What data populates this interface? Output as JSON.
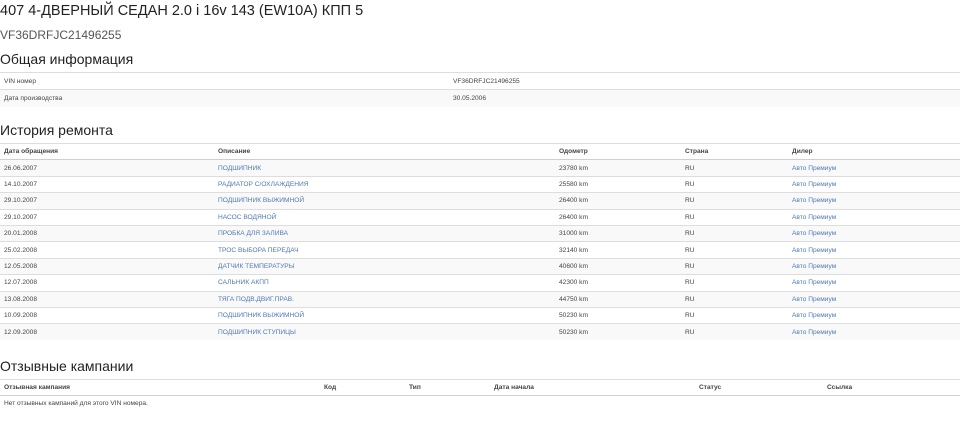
{
  "header": {
    "title": "407 4-ДВЕРНЫЙ СЕДАН 2.0 i 16v 143 (EW10A) КПП 5",
    "vin": "VF36DRFJC21496255"
  },
  "general": {
    "title": "Общая информация",
    "rows": [
      {
        "label": "VIN номер",
        "value": "VF36DRFJC21496255"
      },
      {
        "label": "Дата производства",
        "value": "30.05.2006"
      }
    ]
  },
  "history": {
    "title": "История ремонта",
    "columns": [
      "Дата обращения",
      "Описание",
      "Одометр",
      "Страна",
      "Дилер"
    ],
    "rows": [
      {
        "date": "26.06.2007",
        "desc": "ПОДШИПНИК",
        "odo": "23780 km",
        "country": "RU",
        "dealer": "Авто Премиум"
      },
      {
        "date": "14.10.2007",
        "desc": "РАДИАТОР С/ОХЛАЖДЕНИЯ",
        "odo": "25580 km",
        "country": "RU",
        "dealer": "Авто Премиум"
      },
      {
        "date": "29.10.2007",
        "desc": "ПОДШИПНИК ВЫЖИМНОЙ",
        "odo": "26400 km",
        "country": "RU",
        "dealer": "Авто Премиум"
      },
      {
        "date": "29.10.2007",
        "desc": "НАСОС ВОДЯНОЙ",
        "odo": "26400 km",
        "country": "RU",
        "dealer": "Авто Премиум"
      },
      {
        "date": "20.01.2008",
        "desc": "ПРОБКА ДЛЯ ЗАЛИВА",
        "odo": "31000 km",
        "country": "RU",
        "dealer": "Авто Премиум"
      },
      {
        "date": "25.02.2008",
        "desc": "ТРОС ВЫБОРА ПЕРЕДАЧ",
        "odo": "32140 km",
        "country": "RU",
        "dealer": "Авто Премиум"
      },
      {
        "date": "12.05.2008",
        "desc": "ДАТЧИК ТЕМПЕРАТУРЫ",
        "odo": "40600 km",
        "country": "RU",
        "dealer": "Авто Премиум"
      },
      {
        "date": "12.07.2008",
        "desc": "САЛЬНИК АКПП",
        "odo": "42300 km",
        "country": "RU",
        "dealer": "Авто Премиум"
      },
      {
        "date": "13.08.2008",
        "desc": "ТЯГА ПОДВ.ДВИГ.ПРАВ.",
        "odo": "44750 km",
        "country": "RU",
        "dealer": "Авто Премиум"
      },
      {
        "date": "10.09.2008",
        "desc": "ПОДШИПНИК ВЫЖИМНОЙ",
        "odo": "50230 km",
        "country": "RU",
        "dealer": "Авто Премиум"
      },
      {
        "date": "12.09.2008",
        "desc": "ПОДШИПНИК СТУПИЦЫ",
        "odo": "50230 km",
        "country": "RU",
        "dealer": "Авто Премиум"
      }
    ]
  },
  "campaigns": {
    "title": "Отзывные кампании",
    "columns": [
      "Отзывная кампания",
      "Код",
      "Тип",
      "Дата начала",
      "Статус",
      "Ссылка"
    ],
    "empty_text": "Нет отзывных кампаний для этого VIN номера."
  },
  "colors": {
    "link": "#4f79b5",
    "border": "#dddddd",
    "stripe": "#f9f9f9"
  }
}
